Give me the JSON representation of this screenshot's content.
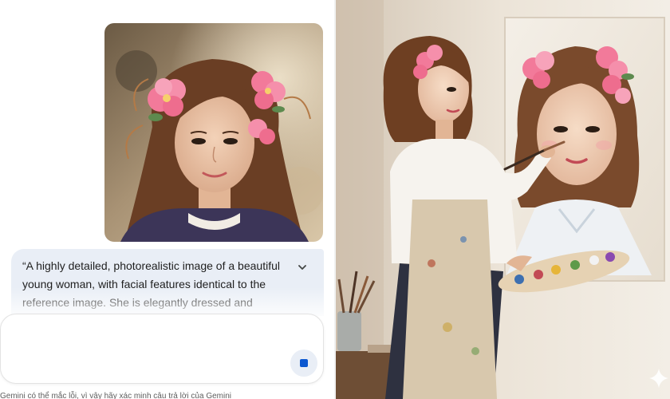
{
  "conversation": {
    "uploaded_image_description_icon": "photo-icon",
    "prompt": {
      "text": "“A highly detailed, photorealistic image of a beautiful young woman, with facial features identical to the reference image. She is elegantly dressed and painting...",
      "expand_icon": "chevron-down-icon"
    },
    "input": {
      "value": "",
      "placeholder": ""
    },
    "stop_button_icon": "stop-icon",
    "disclaimer": "Gemini có thể mắc lỗi, vì vậy hãy xác minh câu trả lời của Gemini"
  },
  "generated": {
    "watermark_icon": "sparkle-icon"
  },
  "colors": {
    "prompt_bubble": "#e9eef6",
    "stop_accent": "#0b57d0",
    "wall": "#ece4d8"
  }
}
